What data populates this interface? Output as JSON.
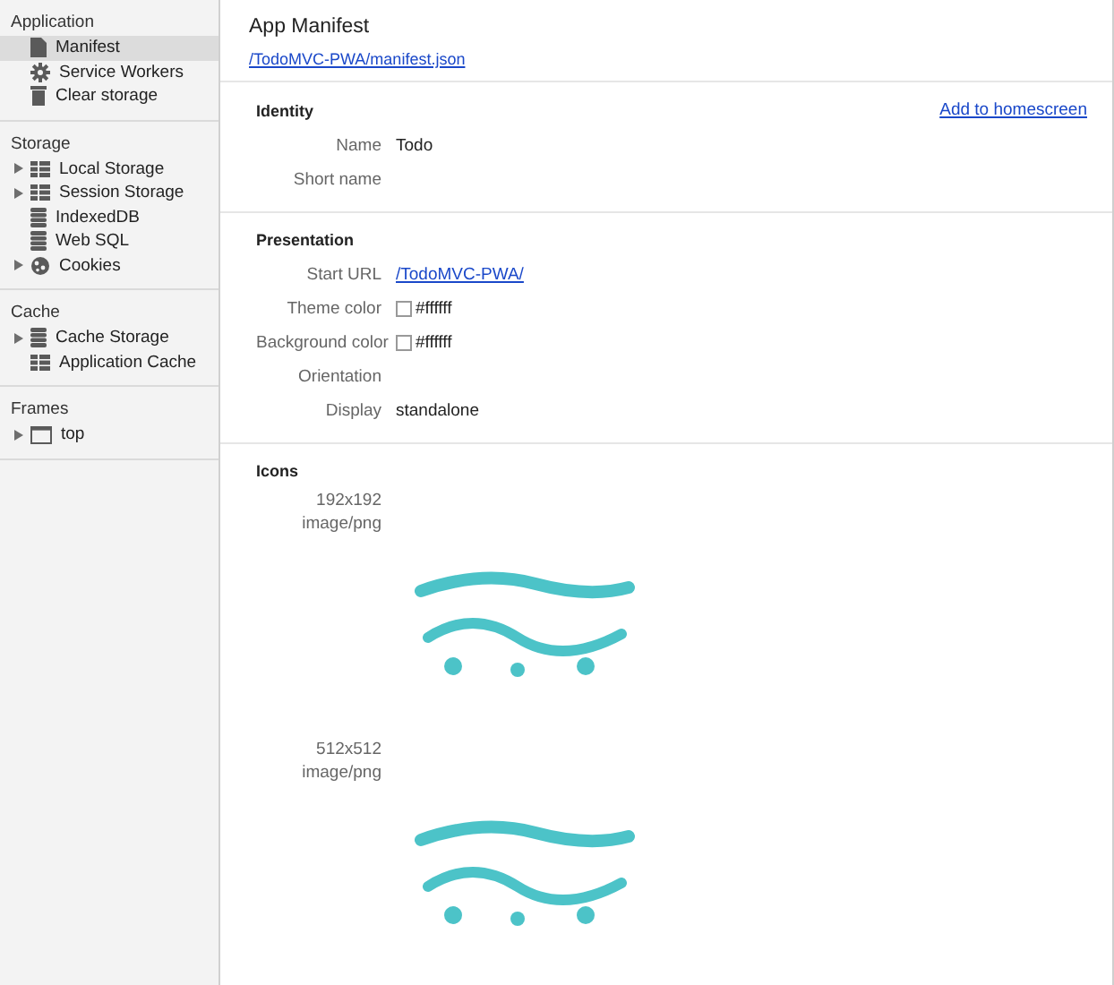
{
  "sidebar": {
    "sections": [
      {
        "title": "Application",
        "items": [
          {
            "label": "Manifest",
            "kind": "document",
            "selected": true
          },
          {
            "label": "Service Workers",
            "kind": "gear",
            "selected": false
          },
          {
            "label": "Clear storage",
            "kind": "trash",
            "selected": false
          }
        ]
      },
      {
        "title": "Storage",
        "items": [
          {
            "label": "Local Storage",
            "kind": "grid",
            "selected": false,
            "expanded": false
          },
          {
            "label": "Session Storage",
            "kind": "grid",
            "selected": false,
            "expanded": false
          },
          {
            "label": "IndexedDB",
            "kind": "database",
            "selected": false
          },
          {
            "label": "Web SQL",
            "kind": "database",
            "selected": false
          },
          {
            "label": "Cookies",
            "kind": "cookie",
            "selected": false,
            "expanded": false
          }
        ]
      },
      {
        "title": "Cache",
        "items": [
          {
            "label": "Cache Storage",
            "kind": "database",
            "selected": false,
            "expanded": false
          },
          {
            "label": "Application Cache",
            "kind": "grid",
            "selected": false
          }
        ]
      },
      {
        "title": "Frames",
        "items": [
          {
            "label": "top",
            "kind": "frame",
            "selected": false,
            "expanded": false
          }
        ]
      }
    ]
  },
  "main": {
    "title": "App Manifest",
    "manifest_url": "/TodoMVC-PWA/manifest.json",
    "sections": [
      {
        "title": "Identity",
        "action": "Add to homescreen",
        "rows": [
          {
            "label": "Name",
            "kind": "text",
            "value": "Todo"
          },
          {
            "label": "Short name"
          }
        ]
      },
      {
        "title": "Presentation",
        "rows": [
          {
            "label": "Start URL",
            "kind": "link",
            "value": "/TodoMVC-PWA/"
          },
          {
            "label": "Theme color",
            "kind": "color",
            "value": "#ffffff"
          },
          {
            "label": "Background color",
            "kind": "color",
            "value": "#ffffff"
          },
          {
            "label": "Orientation"
          },
          {
            "label": "Display",
            "kind": "text",
            "value": "standalone"
          }
        ]
      }
    ],
    "icons": {
      "title": "Icons",
      "items": [
        {
          "size": "192x192",
          "type": "image/png",
          "kind": "picture"
        },
        {
          "size": "512x512",
          "type": "image/png",
          "kind": "picture"
        }
      ]
    }
  }
}
